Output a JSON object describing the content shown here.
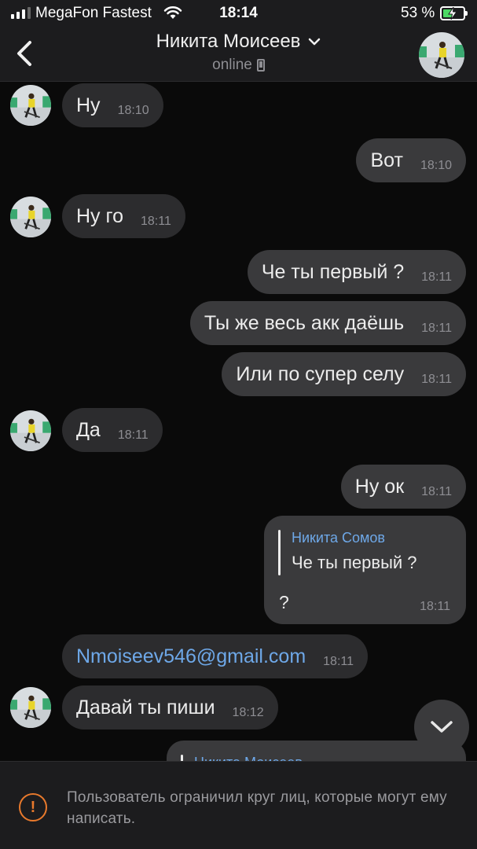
{
  "status_bar": {
    "carrier": "MegaFon Fastest",
    "time": "18:14",
    "battery_percent": "53 %",
    "battery_level": 0.53,
    "signal_bars": 3
  },
  "header": {
    "title": "Никита Моисеев",
    "subtitle": "online"
  },
  "messages": [
    {
      "dir": "in",
      "text": "Ну",
      "time": "18:10"
    },
    {
      "dir": "out",
      "text": "Вот",
      "time": "18:10"
    },
    {
      "dir": "in",
      "text": "Ну го",
      "time": "18:11"
    },
    {
      "dir": "out",
      "text": "Че ты первый ?",
      "time": "18:11"
    },
    {
      "dir": "out",
      "text": "Ты же весь акк даёшь",
      "time": "18:11"
    },
    {
      "dir": "out",
      "text": "Или по супер селу",
      "time": "18:11"
    },
    {
      "dir": "in",
      "text": "Да",
      "time": "18:11"
    },
    {
      "dir": "out",
      "text": "Ну ок",
      "time": "18:11"
    },
    {
      "dir": "in",
      "text": "Nmoiseev546@gmail.com",
      "time": "18:11"
    },
    {
      "dir": "in",
      "text": "Давай ты пиши",
      "time": "18:12"
    }
  ],
  "reply_message": {
    "author": "Никита Сомов",
    "quote": "Че ты первый ?",
    "text": "?",
    "time": "18:11"
  },
  "partial_reply": {
    "author": "Никита Моисеев"
  },
  "footer": {
    "notice": "Пользователь ограничил круг лиц, которые могут ему написать."
  },
  "colors": {
    "background": "#0a0a0a",
    "bubble_in": "#2c2c2e",
    "bubble_out": "#3a3a3c",
    "link": "#6ea8e8",
    "warning": "#e8792c",
    "battery": "#4cd964"
  }
}
